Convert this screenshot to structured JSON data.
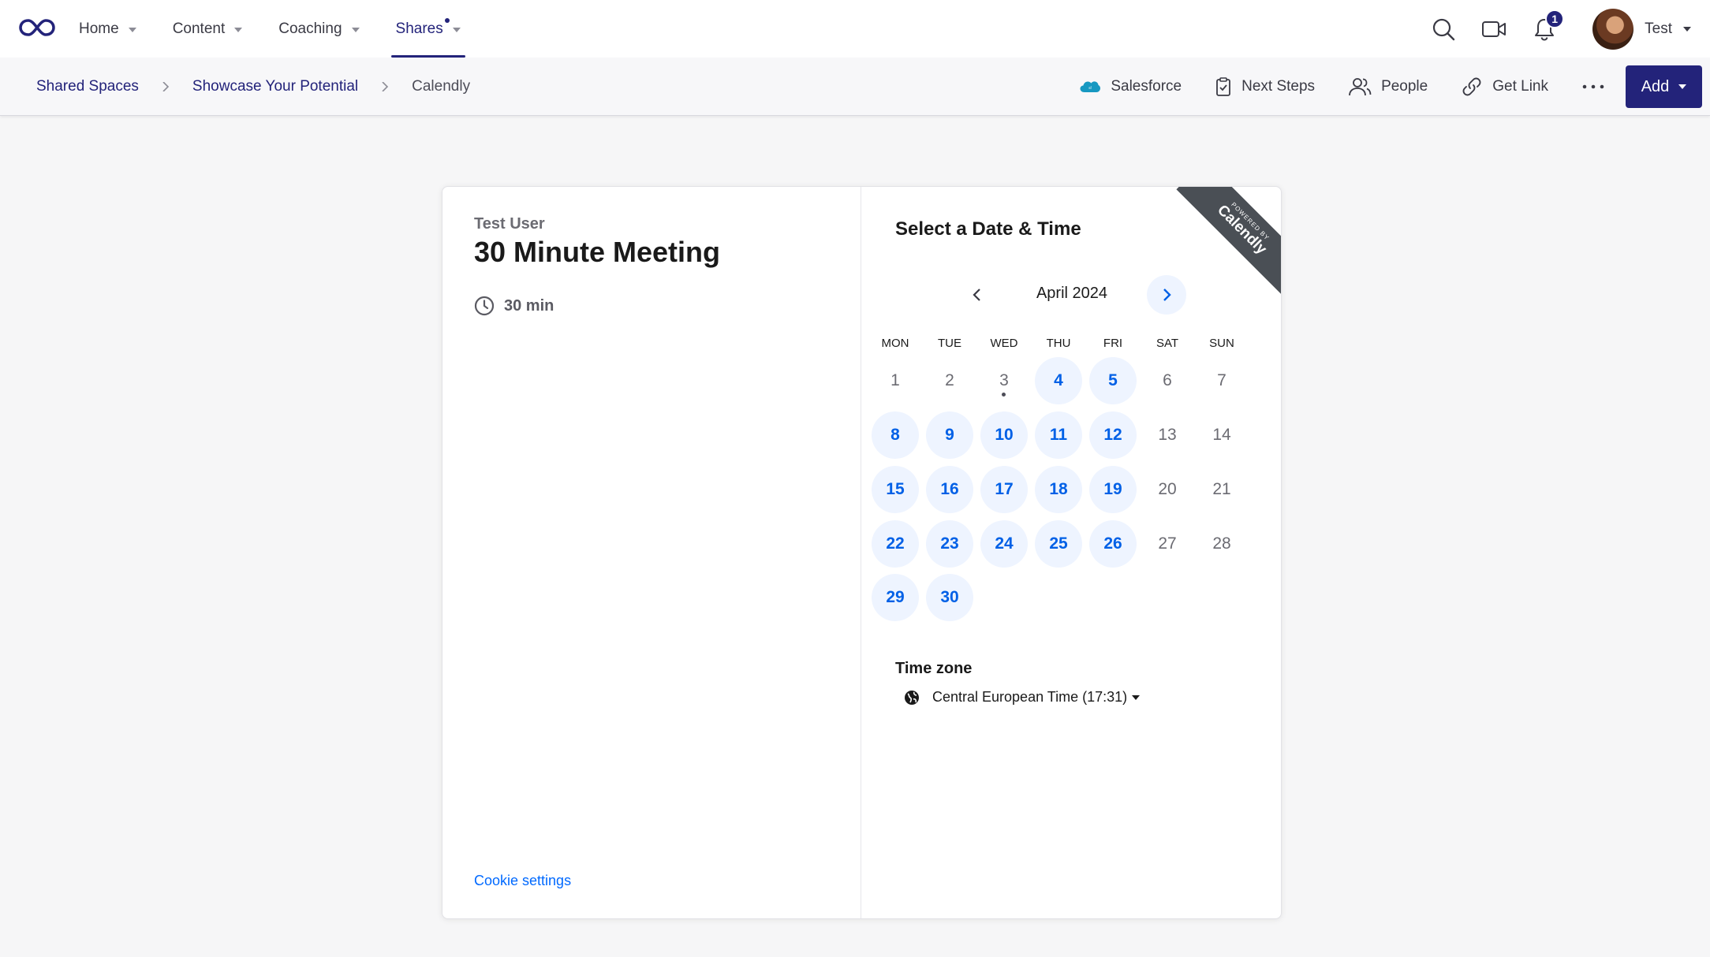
{
  "nav": {
    "items": [
      {
        "label": "Home",
        "active": false
      },
      {
        "label": "Content",
        "active": false
      },
      {
        "label": "Coaching",
        "active": false
      },
      {
        "label": "Shares",
        "active": true
      }
    ],
    "notification_count": "1",
    "user_name": "Test",
    "brand_color": "#23237a"
  },
  "breadcrumb": {
    "items": [
      "Shared Spaces",
      "Showcase Your Potential",
      "Calendly"
    ]
  },
  "actions": {
    "salesforce": "Salesforce",
    "next_steps": "Next Steps",
    "people": "People",
    "get_link": "Get Link",
    "add": "Add"
  },
  "widget": {
    "organizer": "Test User",
    "event_title": "30 Minute Meeting",
    "duration": "30 min",
    "cookie_settings": "Cookie settings",
    "select_title": "Select a Date & Time",
    "ribbon_top": "POWERED BY",
    "ribbon_brand": "Calendly",
    "month": "April 2024",
    "weekdays": [
      "MON",
      "TUE",
      "WED",
      "THU",
      "FRI",
      "SAT",
      "SUN"
    ],
    "days": [
      {
        "n": "1",
        "available": false
      },
      {
        "n": "2",
        "available": false
      },
      {
        "n": "3",
        "available": false,
        "today": true
      },
      {
        "n": "4",
        "available": true
      },
      {
        "n": "5",
        "available": true
      },
      {
        "n": "6",
        "available": false
      },
      {
        "n": "7",
        "available": false
      },
      {
        "n": "8",
        "available": true
      },
      {
        "n": "9",
        "available": true
      },
      {
        "n": "10",
        "available": true
      },
      {
        "n": "11",
        "available": true
      },
      {
        "n": "12",
        "available": true
      },
      {
        "n": "13",
        "available": false
      },
      {
        "n": "14",
        "available": false
      },
      {
        "n": "15",
        "available": true
      },
      {
        "n": "16",
        "available": true
      },
      {
        "n": "17",
        "available": true
      },
      {
        "n": "18",
        "available": true
      },
      {
        "n": "19",
        "available": true
      },
      {
        "n": "20",
        "available": false
      },
      {
        "n": "21",
        "available": false
      },
      {
        "n": "22",
        "available": true
      },
      {
        "n": "23",
        "available": true
      },
      {
        "n": "24",
        "available": true
      },
      {
        "n": "25",
        "available": true
      },
      {
        "n": "26",
        "available": true
      },
      {
        "n": "27",
        "available": false
      },
      {
        "n": "28",
        "available": false
      },
      {
        "n": "29",
        "available": true
      },
      {
        "n": "30",
        "available": true
      }
    ],
    "timezone_label": "Time zone",
    "timezone_value": "Central European Time (17:31)",
    "accent_color": "#0069ff"
  }
}
